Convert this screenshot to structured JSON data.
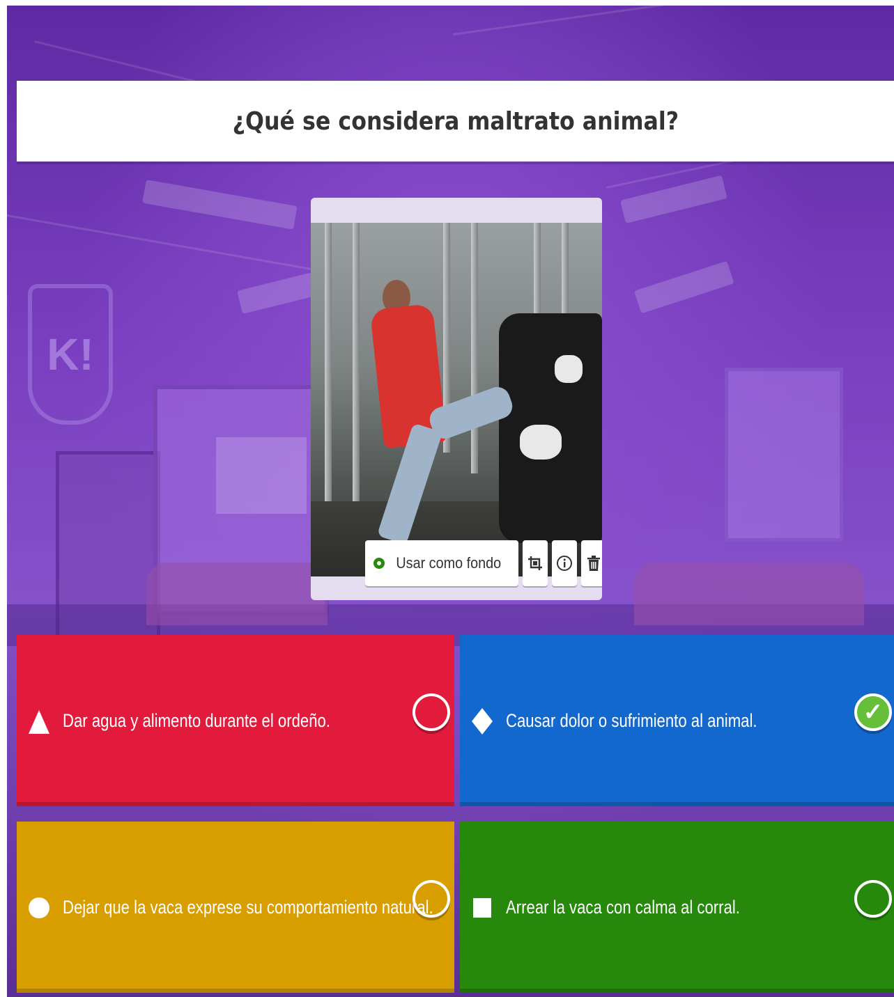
{
  "question": {
    "title": "¿Qué se considera maltrato animal?"
  },
  "media": {
    "image_alt": "Trabajador pateando a una vaca en la sala de ordeño",
    "use_as_background_label": "Usar como fondo",
    "tools": [
      "crop-icon",
      "info-icon",
      "trash-icon"
    ]
  },
  "answers": [
    {
      "shape": "triangle",
      "color": "#e21b3c",
      "text": "Dar agua y alimento durante el ordeño.",
      "correct": false
    },
    {
      "shape": "diamond",
      "color": "#1368ce",
      "text": "Causar dolor o sufrimiento al animal.",
      "correct": true
    },
    {
      "shape": "circle",
      "color": "#d89e00",
      "text": "Dejar que la vaca exprese su comportamiento natural.",
      "correct": false
    },
    {
      "shape": "square",
      "color": "#26890c",
      "text": "Arrear la vaca con calma al corral.",
      "correct": false
    }
  ],
  "colors": {
    "correct_check": "#66bf39",
    "background": "#7a3fc0"
  }
}
